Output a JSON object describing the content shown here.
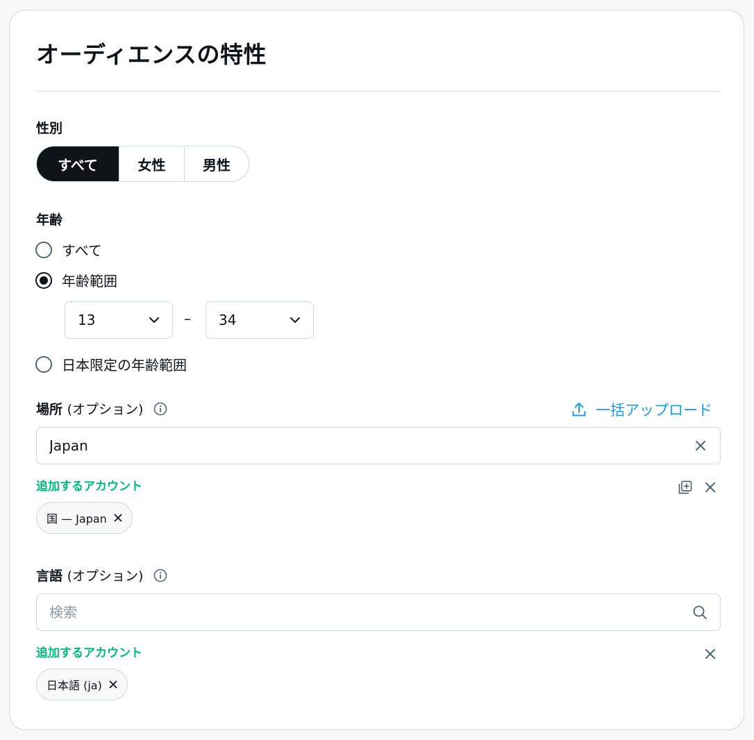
{
  "title": "オーディエンスの特性",
  "gender": {
    "label": "性別",
    "options": [
      "すべて",
      "女性",
      "男性"
    ],
    "selected": "すべて"
  },
  "age": {
    "label": "年齢",
    "options": [
      "すべて",
      "年齢範囲",
      "日本限定の年齢範囲"
    ],
    "selected": "年齢範囲",
    "range_min": "13",
    "range_separator": "–",
    "range_max": "34"
  },
  "location": {
    "label": "場所",
    "optional": "(オプション)",
    "bulk_upload": "一括アップロード",
    "input_value": "Japan",
    "added_label": "追加するアカウント",
    "chips": [
      "国 — Japan"
    ]
  },
  "language": {
    "label": "言語",
    "optional": "(オプション)",
    "placeholder": "検索",
    "added_label": "追加するアカウント",
    "chips": [
      "日本語 (ja)"
    ]
  },
  "colors": {
    "primary_text": "#0f1419",
    "accent_blue": "#1d9bf0",
    "accent_green": "#00ba7c",
    "border": "#cfd9de"
  }
}
